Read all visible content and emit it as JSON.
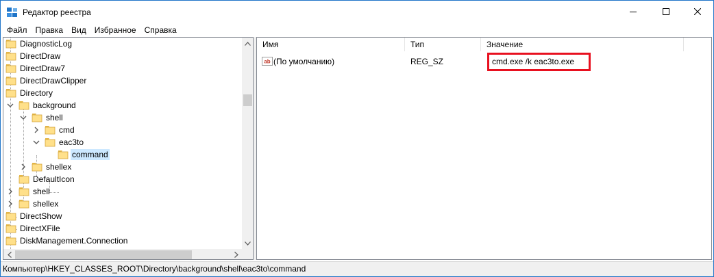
{
  "window": {
    "title": "Редактор реестра",
    "minimize_icon": "minimize-icon",
    "maximize_icon": "maximize-icon",
    "close_icon": "close-icon"
  },
  "menu": [
    "Файл",
    "Правка",
    "Вид",
    "Избранное",
    "Справка"
  ],
  "tree": {
    "items": [
      {
        "label": "DiagnosticLog",
        "expander": "none",
        "selected": false
      },
      {
        "label": "DirectDraw",
        "expander": "none",
        "selected": false
      },
      {
        "label": "DirectDraw7",
        "expander": "none",
        "selected": false
      },
      {
        "label": "DirectDrawClipper",
        "expander": "none",
        "selected": false
      },
      {
        "label": "Directory",
        "expander": "none",
        "selected": false
      },
      {
        "label": "background",
        "expander": "expanded",
        "selected": false
      },
      {
        "label": "shell",
        "expander": "expanded",
        "selected": false
      },
      {
        "label": "cmd",
        "expander": "collapsed",
        "selected": false
      },
      {
        "label": "eac3to",
        "expander": "expanded",
        "selected": false
      },
      {
        "label": "command",
        "expander": "none",
        "selected": true
      },
      {
        "label": "shellex",
        "expander": "collapsed",
        "selected": false
      },
      {
        "label": "DefaultIcon",
        "expander": "none",
        "selected": false
      },
      {
        "label": "shell",
        "expander": "collapsed",
        "selected": false
      },
      {
        "label": "shellex",
        "expander": "collapsed",
        "selected": false
      },
      {
        "label": "DirectShow",
        "expander": "none",
        "selected": false
      },
      {
        "label": "DirectXFile",
        "expander": "none",
        "selected": false
      },
      {
        "label": "DiskManagement.Connection",
        "expander": "none",
        "selected": false
      }
    ]
  },
  "list": {
    "columns": {
      "name": "Имя",
      "type": "Тип",
      "value": "Значение"
    },
    "rows": [
      {
        "name": "(По умолчанию)",
        "type": "REG_SZ",
        "value": "cmd.exe /k eac3to.exe",
        "icon": "string-value-icon"
      }
    ]
  },
  "status": {
    "path": "Компьютер\\HKEY_CLASSES_ROOT\\Directory\\background\\shell\\eac3to\\command"
  },
  "colors": {
    "selection": "#cce8ff",
    "highlight_border": "#e8101f",
    "folder": "#ffe08a",
    "window_border": "#1e74c8"
  }
}
